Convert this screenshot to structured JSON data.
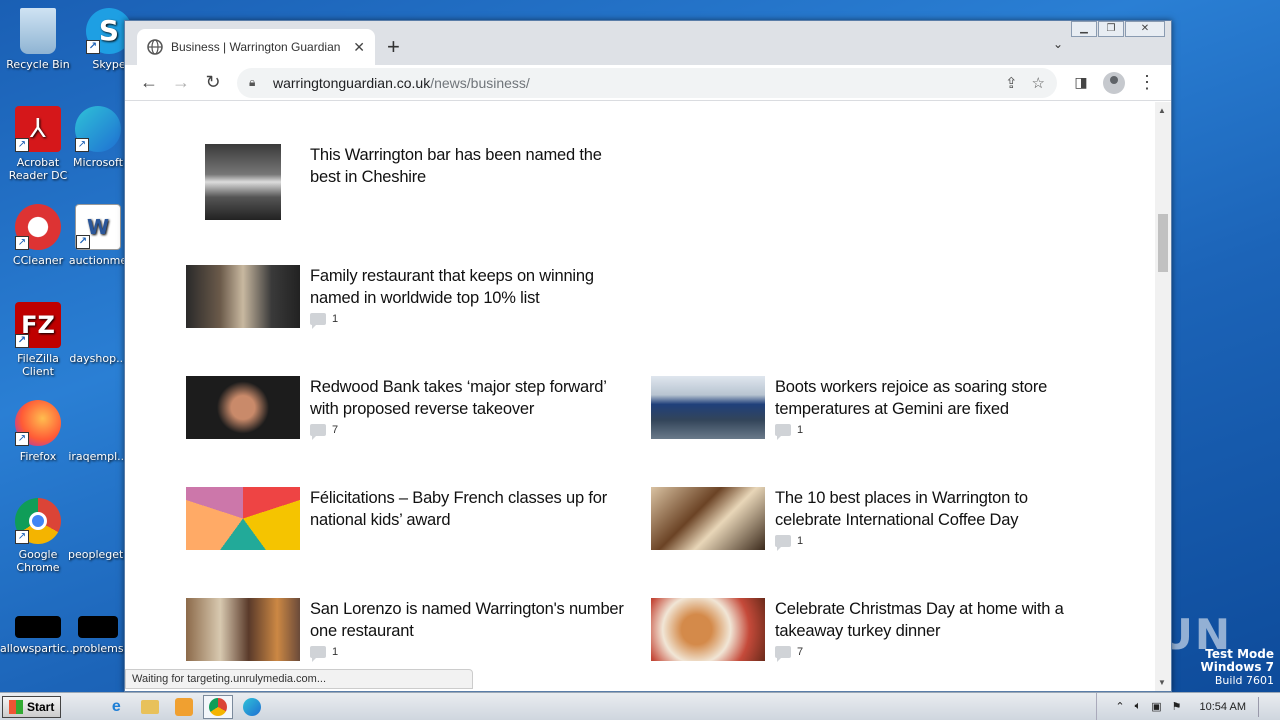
{
  "desktop": {
    "icons": [
      {
        "label": "Recycle Bin"
      },
      {
        "label": "Skype"
      },
      {
        "label": "Acrobat Reader DC"
      },
      {
        "label": "Microsoft"
      },
      {
        "label": "CCleaner"
      },
      {
        "label": "auctionme"
      },
      {
        "label": "FileZilla Client"
      },
      {
        "label": "dayshop..."
      },
      {
        "label": "Firefox"
      },
      {
        "label": "iraqempl..."
      },
      {
        "label": "Google Chrome"
      },
      {
        "label": "peopleget..."
      },
      {
        "label": "allowspartic..."
      },
      {
        "label": "problems"
      }
    ]
  },
  "browser": {
    "tab_title": "Business | Warrington Guardian",
    "url_domain": "warringtonguardian.co.uk",
    "url_path": "/news/business/",
    "status_text": "Waiting for targeting.unrulymedia.com..."
  },
  "articles": [
    {
      "title": "This Warrington bar has been named the best in Cheshire",
      "comments": ""
    },
    {
      "title": "Family restaurant that keeps on winning named in worldwide top 10% list",
      "comments": "1"
    },
    {
      "title": "Redwood Bank takes ‘major step forward’ with proposed reverse takeover",
      "comments": "7"
    },
    {
      "title": "Boots workers rejoice as soaring store temperatures at Gemini are fixed",
      "comments": "1"
    },
    {
      "title": "Félicitations – Baby French classes up for national kids’ award",
      "comments": ""
    },
    {
      "title": "The 10 best places in Warrington to celebrate International Coffee Day",
      "comments": "1"
    },
    {
      "title": "San Lorenzo is named Warrington's number one restaurant",
      "comments": "1"
    },
    {
      "title": "Celebrate Christmas Day at home with a takeaway turkey dinner",
      "comments": "7"
    }
  ],
  "taskbar": {
    "start_label": "Start",
    "clock": "10:54 AM"
  },
  "watermark": {
    "brand": "ANY RUN",
    "mode_line1": "Test Mode",
    "mode_line2": "Windows 7",
    "mode_line3": "Build 7601"
  },
  "colors": {
    "desktop_blue": "#1a5fb4",
    "tab_strip": "#dee1e6",
    "omnibox_bg": "#f1f3f4"
  }
}
